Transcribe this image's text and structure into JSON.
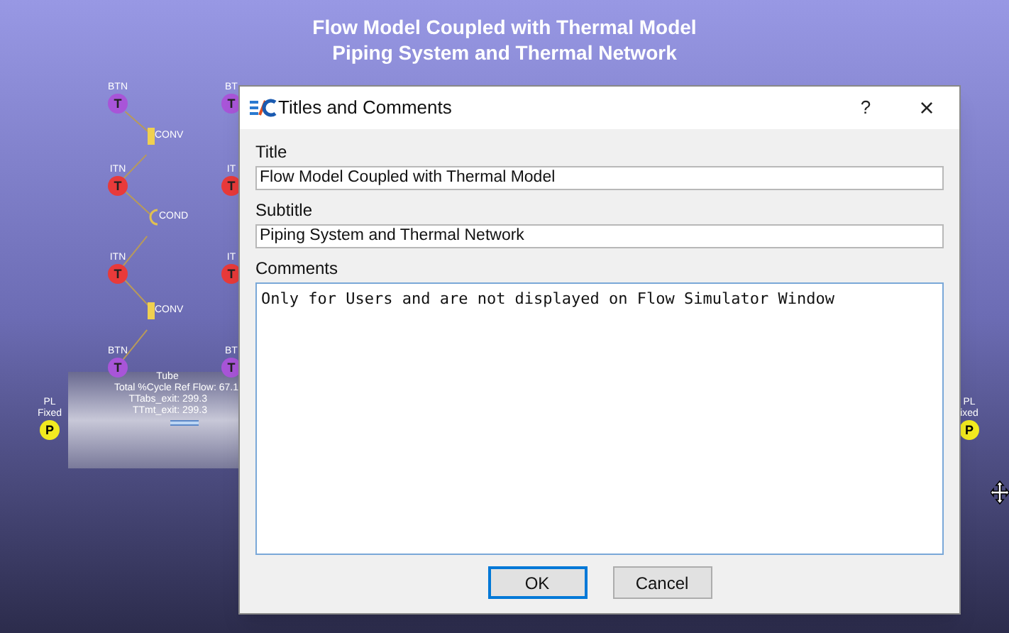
{
  "canvas": {
    "title_lines": [
      "Flow Model Coupled with Thermal Model",
      "Piping System and Thermal Network"
    ],
    "nodes": [
      {
        "kind": "btn",
        "label": "BTN",
        "symbol": "T"
      },
      {
        "kind": "conv",
        "label": "CONV"
      },
      {
        "kind": "itn",
        "label": "ITN",
        "symbol": "T"
      },
      {
        "kind": "cond",
        "label": "COND"
      },
      {
        "kind": "itn",
        "label": "ITN",
        "symbol": "T"
      },
      {
        "kind": "conv",
        "label": "CONV"
      },
      {
        "kind": "btn",
        "label": "BTN",
        "symbol": "T"
      },
      {
        "kind": "btn",
        "label": "BT",
        "symbol": "T"
      },
      {
        "kind": "itn",
        "label": "IT",
        "symbol": "T"
      },
      {
        "kind": "itn",
        "label": "IT",
        "symbol": "T"
      },
      {
        "kind": "btn",
        "label": "BT",
        "symbol": "T"
      },
      {
        "kind": "pl",
        "label": "PL",
        "sublabel": "Fixed",
        "symbol": "P"
      },
      {
        "kind": "pl",
        "label": "PL",
        "sublabel": "ixed",
        "symbol": "P"
      }
    ],
    "tube": {
      "name": "Tube",
      "lines": [
        "Total %Cycle Ref Flow: 67.1",
        "TTabs_exit: 299.3",
        "TTmt_exit: 299.3"
      ]
    }
  },
  "dialog": {
    "title": "Titles and Comments",
    "help": "?",
    "close": "×",
    "fields": [
      {
        "label": "Title",
        "value": "Flow Model Coupled with Thermal Model"
      },
      {
        "label": "Subtitle",
        "value": "Piping System and Thermal Network"
      }
    ],
    "comments": {
      "label": "Comments",
      "value": "Only for Users and are not displayed on Flow Simulator Window"
    },
    "buttons": [
      {
        "label": "OK",
        "default": true
      },
      {
        "label": "Cancel",
        "default": false
      }
    ]
  }
}
